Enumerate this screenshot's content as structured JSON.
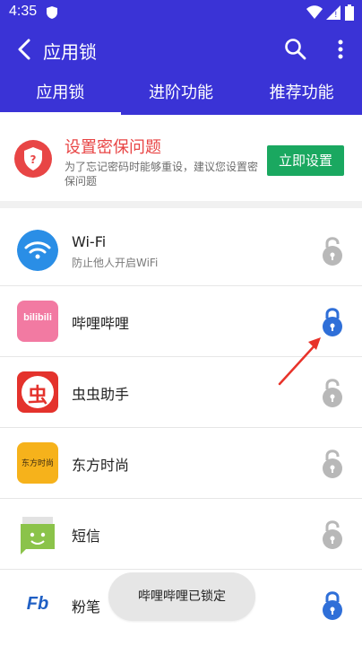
{
  "status": {
    "time": "4:35"
  },
  "appbar": {
    "title": "应用锁"
  },
  "tabs": [
    {
      "label": "应用锁",
      "active": true
    },
    {
      "label": "进阶功能",
      "active": false
    },
    {
      "label": "推荐功能",
      "active": false
    }
  ],
  "banner": {
    "title": "设置密保问题",
    "desc": "为了忘记密码时能够重设，建议您设置密保问题",
    "button": "立即设置"
  },
  "apps": [
    {
      "name": "Wi-Fi",
      "sub": "防止他人开启WiFi",
      "locked": false
    },
    {
      "name": "哔哩哔哩",
      "locked": true,
      "icon_text": "bilibili"
    },
    {
      "name": "虫虫助手",
      "locked": false,
      "icon_text": "虫"
    },
    {
      "name": "东方时尚",
      "locked": false,
      "icon_text": "东方时尚"
    },
    {
      "name": "短信",
      "locked": false
    },
    {
      "name": "粉笔",
      "locked": true,
      "icon_text": "Fb"
    }
  ],
  "toast": "哔哩哔哩已锁定",
  "colors": {
    "primary": "#3a33d6",
    "accent_red": "#e84545",
    "green": "#1aa860",
    "lock_blue": "#2f6fd8",
    "lock_gray": "#b8b8b8"
  }
}
